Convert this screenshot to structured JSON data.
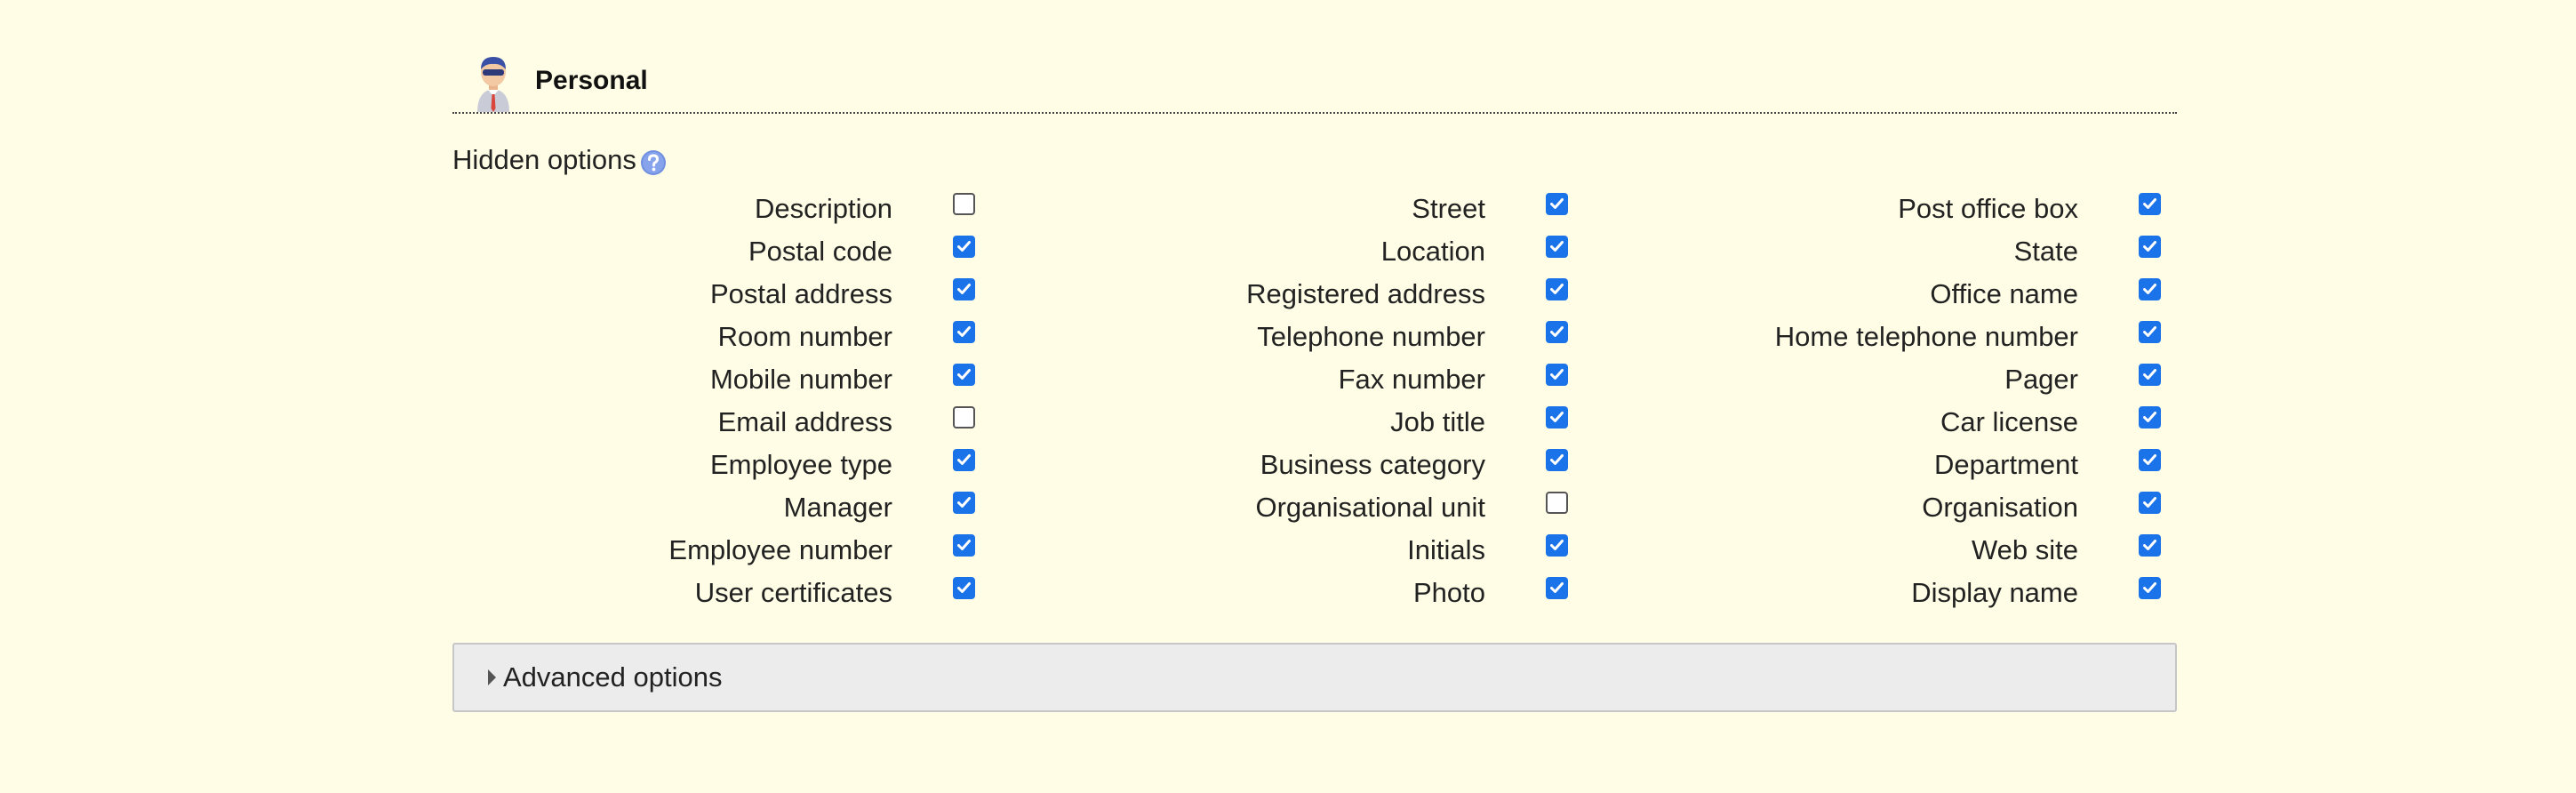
{
  "section": {
    "title": "Personal",
    "icon": "user-avatar-icon"
  },
  "hidden_options": {
    "label": "Hidden options",
    "help_icon": "help-icon"
  },
  "options": [
    {
      "label": "Description",
      "checked": false
    },
    {
      "label": "Street",
      "checked": true
    },
    {
      "label": "Post office box",
      "checked": true
    },
    {
      "label": "Postal code",
      "checked": true
    },
    {
      "label": "Location",
      "checked": true
    },
    {
      "label": "State",
      "checked": true
    },
    {
      "label": "Postal address",
      "checked": true
    },
    {
      "label": "Registered address",
      "checked": true
    },
    {
      "label": "Office name",
      "checked": true
    },
    {
      "label": "Room number",
      "checked": true
    },
    {
      "label": "Telephone number",
      "checked": true
    },
    {
      "label": "Home telephone number",
      "checked": true
    },
    {
      "label": "Mobile number",
      "checked": true
    },
    {
      "label": "Fax number",
      "checked": true
    },
    {
      "label": "Pager",
      "checked": true
    },
    {
      "label": "Email address",
      "checked": false
    },
    {
      "label": "Job title",
      "checked": true
    },
    {
      "label": "Car license",
      "checked": true
    },
    {
      "label": "Employee type",
      "checked": true
    },
    {
      "label": "Business category",
      "checked": true
    },
    {
      "label": "Department",
      "checked": true
    },
    {
      "label": "Manager",
      "checked": true
    },
    {
      "label": "Organisational unit",
      "checked": false
    },
    {
      "label": "Organisation",
      "checked": true
    },
    {
      "label": "Employee number",
      "checked": true
    },
    {
      "label": "Initials",
      "checked": true
    },
    {
      "label": "Web site",
      "checked": true
    },
    {
      "label": "User certificates",
      "checked": true
    },
    {
      "label": "Photo",
      "checked": true
    },
    {
      "label": "Display name",
      "checked": true
    }
  ],
  "advanced": {
    "label": "Advanced options",
    "expanded": false
  },
  "colors": {
    "background": "#fffde5",
    "checkbox_checked": "#1a73e8",
    "advanced_bg": "#ececec"
  }
}
